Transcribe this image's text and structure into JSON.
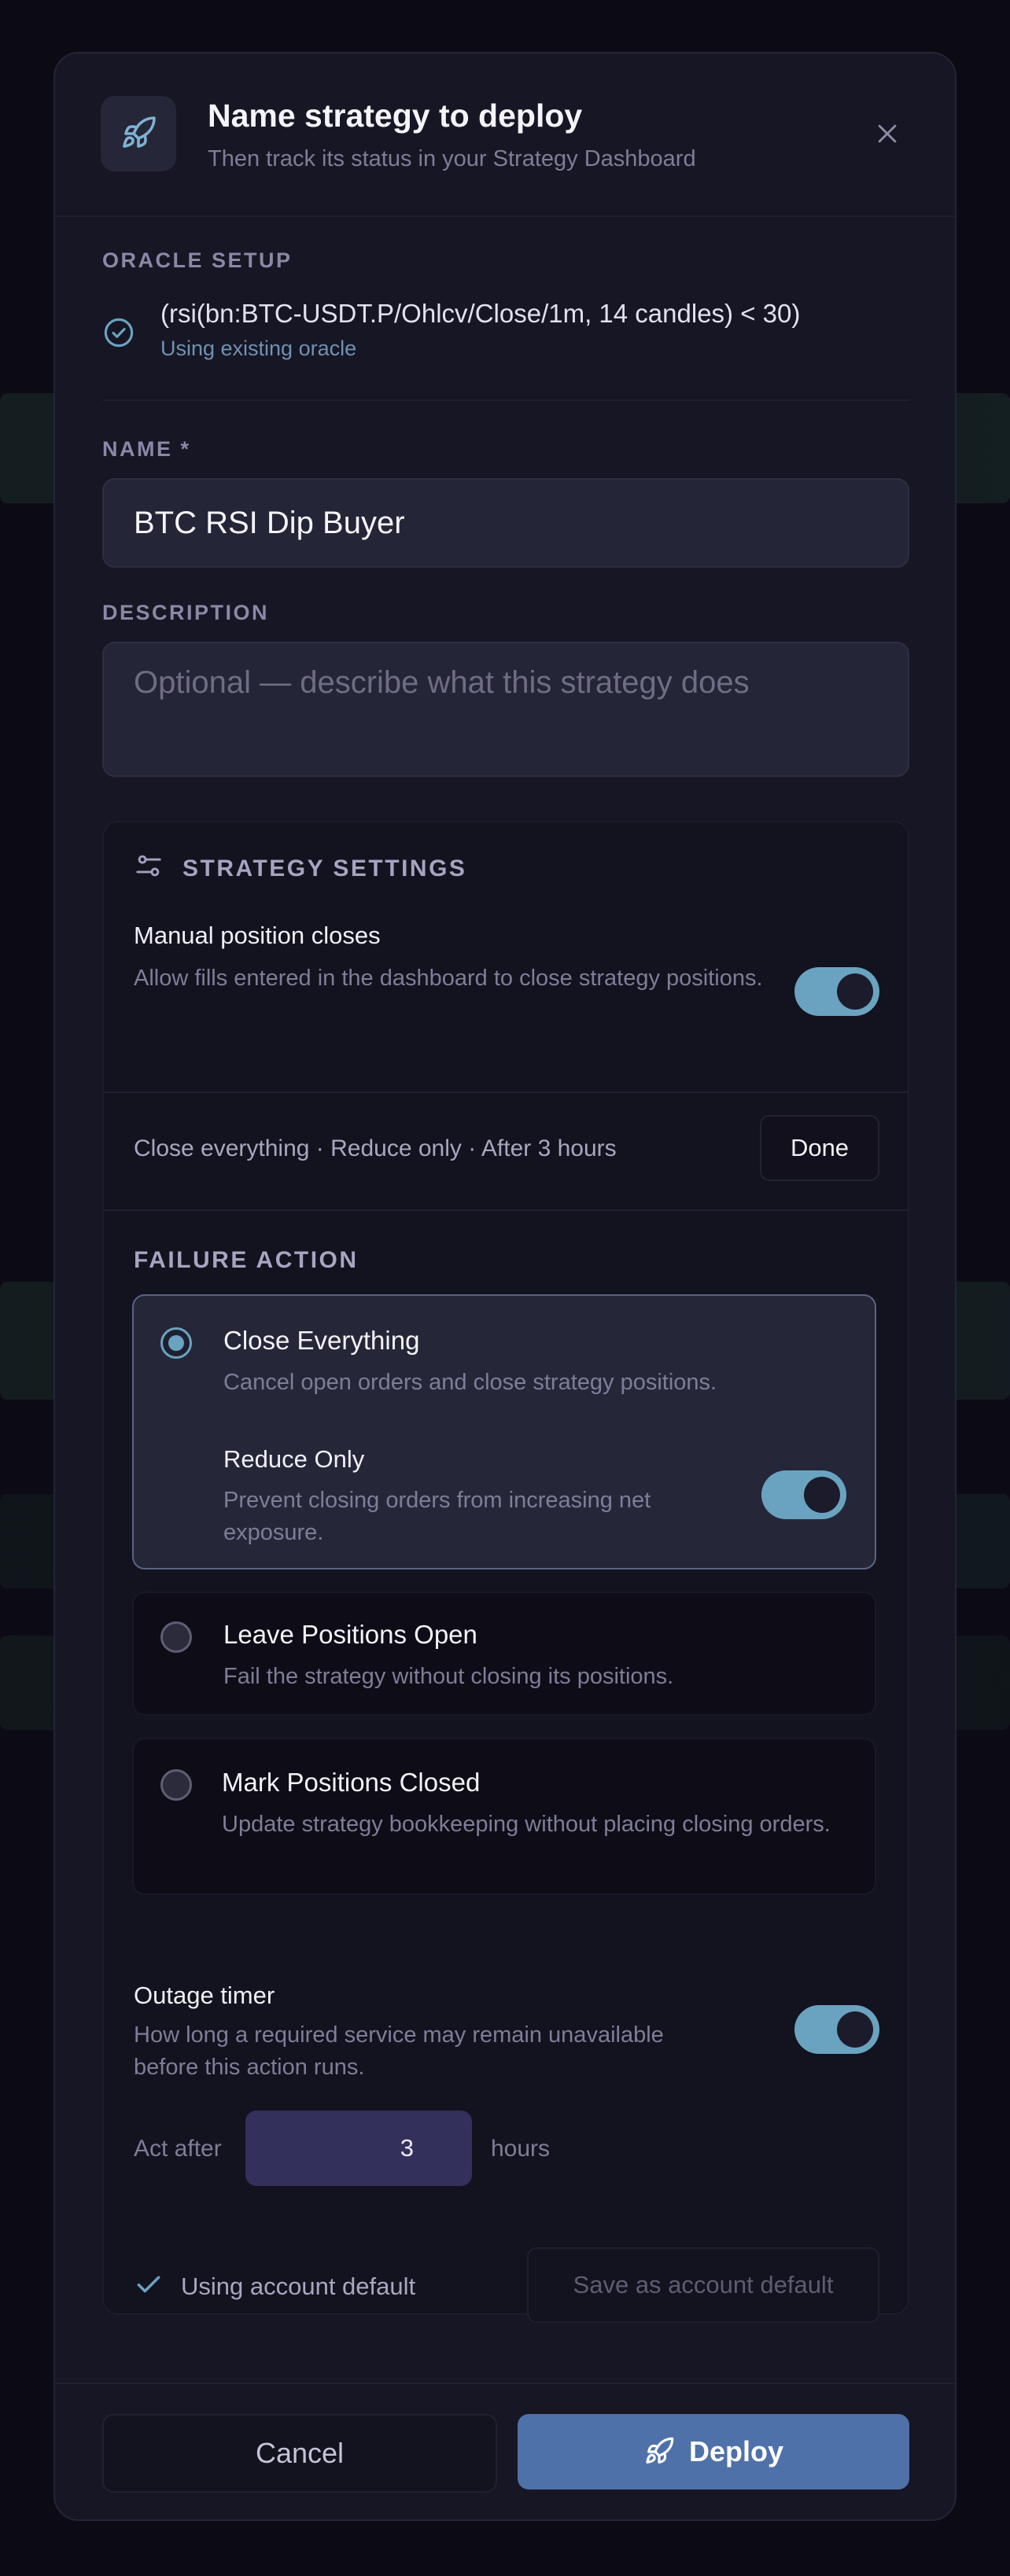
{
  "dialog": {
    "title": "Name strategy to deploy",
    "subtitle": "Then track its status in your Strategy Dashboard"
  },
  "oracle": {
    "section_label": "ORACLE SETUP",
    "expression": "(rsi(bn:BTC-USDT.P/Ohlcv/Close/1m, 14 candles) < 30)",
    "status": "Using existing oracle"
  },
  "name_field": {
    "label": "NAME *",
    "value": "BTC RSI Dip Buyer"
  },
  "description_field": {
    "label": "DESCRIPTION",
    "placeholder": "Optional — describe what this strategy does",
    "value": ""
  },
  "strategy_settings": {
    "section_label": "STRATEGY SETTINGS",
    "manual_closes": {
      "title": "Manual position closes",
      "description": "Allow fills entered in the dashboard to close strategy positions.",
      "enabled": true
    },
    "summary": "Close everything · Reduce only · After 3 hours",
    "done_label": "Done",
    "failure_action": {
      "section_label": "FAILURE ACTION",
      "options": [
        {
          "title": "Close Everything",
          "description": "Cancel open orders and close strategy positions.",
          "selected": true,
          "sub_option": {
            "title": "Reduce Only",
            "description": "Prevent closing orders from increasing net exposure.",
            "enabled": true
          }
        },
        {
          "title": "Leave Positions Open",
          "description": "Fail the strategy without closing its positions.",
          "selected": false
        },
        {
          "title": "Mark Positions Closed",
          "description": "Update strategy bookkeeping without placing closing orders.",
          "selected": false
        }
      ]
    },
    "outage_timer": {
      "title": "Outage timer",
      "description": "How long a required service may remain unavailable before this action runs.",
      "enabled": true,
      "act_after_label": "Act after",
      "hours_value": "3",
      "hours_unit": "hours"
    },
    "account_default_status": "Using account default",
    "save_default_label": "Save as account default"
  },
  "footer": {
    "cancel_label": "Cancel",
    "deploy_label": "Deploy"
  },
  "colors": {
    "accent": "#6aa3c0",
    "deploy": "#4f71a9",
    "hours_input": "#33305c"
  },
  "icons": [
    "rocket-icon",
    "close-icon",
    "check-circle-icon",
    "sliders-icon",
    "checkmark-icon"
  ]
}
